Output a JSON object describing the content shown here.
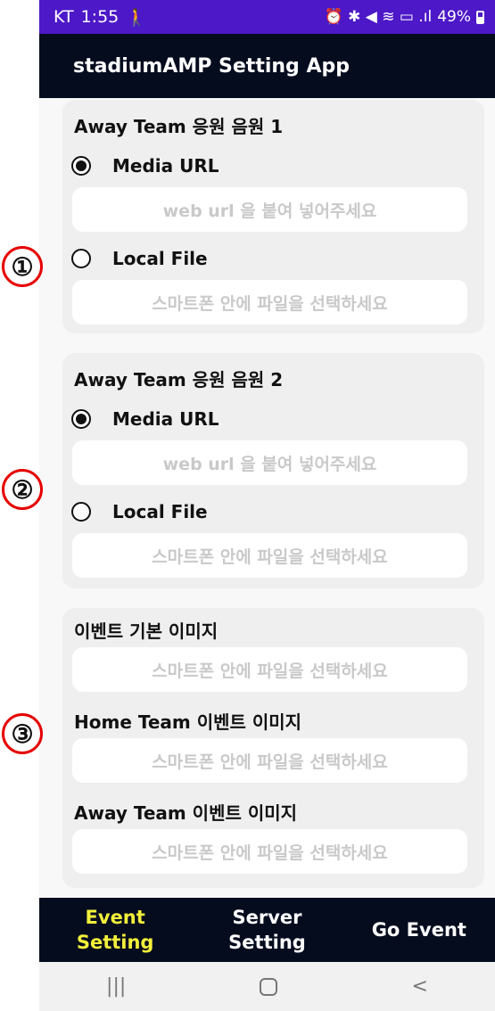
{
  "status_bar": {
    "carrier": "KT",
    "time": "1:55",
    "notification_icon": "person-walk-icon",
    "right_icons": "⏰ ✱ ◀ ≋ ▭ .ıl",
    "battery": "49%"
  },
  "app_bar": {
    "title": "stadiumAMP Setting App"
  },
  "cards": [
    {
      "title": "Away Team 응원 음원 1",
      "option_url": "Media URL",
      "url_placeholder": "web url 을 붙여 넣어주세요",
      "option_file": "Local File",
      "file_placeholder": "스마트폰 안에 파일을 선택하세요",
      "selected": "Media URL"
    },
    {
      "title": "Away Team 응원 음원 2",
      "option_url": "Media URL",
      "url_placeholder": "web url 을 붙여 넣어주세요",
      "option_file": "Local File",
      "file_placeholder": "스마트폰 안에 파일을 선택하세요",
      "selected": "Media URL"
    },
    {
      "title_default": "이벤트  기본 이미지",
      "default_placeholder": "스마트폰 안에 파일을 선택하세요",
      "title_home": "Home Team 이벤트 이미지",
      "home_placeholder": "스마트폰 안에 파일을 선택하세요",
      "title_away": "Away Team 이벤트 이미지",
      "away_placeholder": "스마트폰 안에 파일을 선택하세요"
    }
  ],
  "markers": [
    "①",
    "②",
    "③"
  ],
  "bottom_nav": {
    "event_setting_line1": "Event",
    "event_setting_line2": "Setting",
    "server_setting_line1": "Server",
    "server_setting_line2": "Setting",
    "go_event": "Go Event",
    "active": "Event Setting"
  },
  "system_nav": {
    "recents": "|||",
    "back": "<"
  },
  "colors": {
    "status_bar": "#4d18c8",
    "app_bar": "#050c1e",
    "active_tab": "#f2ef3a",
    "marker_border": "#e60000",
    "placeholder": "#c9c9c9"
  }
}
